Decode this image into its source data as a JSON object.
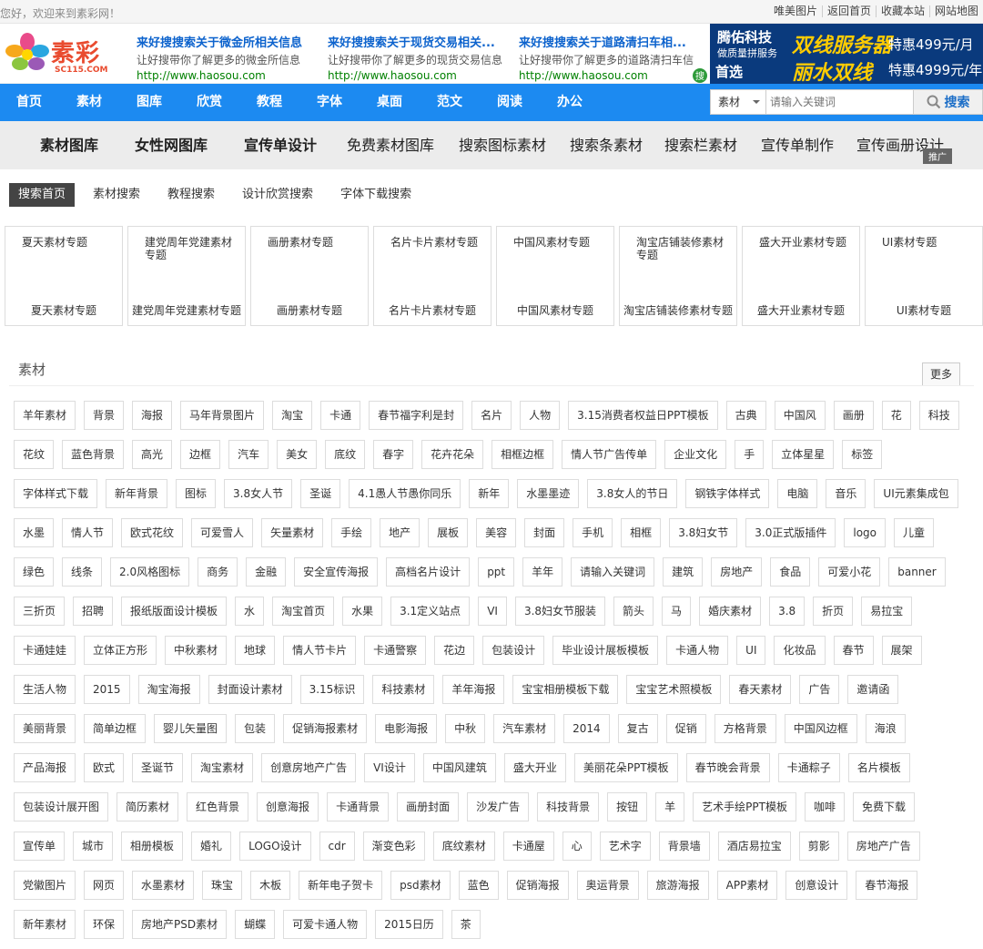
{
  "topbar": {
    "welcome": "您好，欢迎来到素彩网！",
    "links": [
      "唯美图片",
      "返回首页",
      "收藏本站",
      "网站地图"
    ]
  },
  "logo": {
    "name": "素彩",
    "domain": "SC115.COM"
  },
  "ads": [
    {
      "title": "来好搜搜索关于微金所相关信息",
      "desc": "让好搜带你了解更多的微金所信息",
      "url": "http://www.haosou.com"
    },
    {
      "title": "来好搜搜索关于现货交易相关...",
      "desc": "让好搜带你了解更多的现货交易信息",
      "url": "http://www.haosou.com"
    },
    {
      "title": "来好搜搜索关于道路清扫车相...",
      "desc": "让好搜带你了解更多的道路清扫车信",
      "url": "http://www.haosou.com"
    }
  ],
  "banner": {
    "brand": "腾佑科技",
    "slogan": "做质量拼服务",
    "pick": "首选",
    "ad1": "双线服务器",
    "price1": "特惠499元/月",
    "ad2": "丽水双线",
    "price2": "特惠4999元/年"
  },
  "nav": {
    "items": [
      "首页",
      "素材",
      "图库",
      "欣赏",
      "教程",
      "字体",
      "桌面",
      "范文",
      "阅读",
      "办公"
    ]
  },
  "search": {
    "category": "素材",
    "placeholder": "请输入关键词",
    "button": "搜索"
  },
  "subnav": {
    "items": [
      "素材图库",
      "女性网图库",
      "宣传单设计",
      "免费素材图库",
      "搜索图标素材",
      "搜索条素材",
      "搜索栏素材",
      "宣传单制作",
      "宣传画册设计"
    ],
    "tag": "推广"
  },
  "tabs": [
    "搜索首页",
    "素材搜索",
    "教程搜索",
    "设计欣赏搜索",
    "字体下载搜索"
  ],
  "cards": [
    {
      "top": "夏天素材专题",
      "bottom": "夏天素材专题"
    },
    {
      "top": "建党周年党建素材专题",
      "bottom": "建党周年党建素材专题"
    },
    {
      "top": "画册素材专题",
      "bottom": "画册素材专题"
    },
    {
      "top": "名片卡片素材专题",
      "bottom": "名片卡片素材专题"
    },
    {
      "top": "中国风素材专题",
      "bottom": "中国风素材专题"
    },
    {
      "top": "淘宝店铺装修素材专题",
      "bottom": "淘宝店铺装修素材专题"
    },
    {
      "top": "盛大开业素材专题",
      "bottom": "盛大开业素材专题"
    },
    {
      "top": "UI素材专题",
      "bottom": "UI素材专题"
    }
  ],
  "section": {
    "title": "素材",
    "more": "更多"
  },
  "tags": [
    "羊年素材",
    "背景",
    "海报",
    "马年背景图片",
    "淘宝",
    "卡通",
    "春节福字利是封",
    "名片",
    "人物",
    "3.15消费者权益日PPT模板",
    "古典",
    "中国风",
    "画册",
    "花",
    "科技",
    "花纹",
    "蓝色背景",
    "高光",
    "边框",
    "汽车",
    "美女",
    "底纹",
    "春字",
    "花卉花朵",
    "相框边框",
    "情人节广告传单",
    "企业文化",
    "手",
    "立体星星",
    "标签",
    "字体样式下载",
    "新年背景",
    "图标",
    "3.8女人节",
    "圣诞",
    "4.1愚人节愚你同乐",
    "新年",
    "水墨墨迹",
    "3.8女人的节日",
    "钢铁字体样式",
    "电脑",
    "音乐",
    "UI元素集成包",
    "水墨",
    "情人节",
    "欧式花纹",
    "可爱雪人",
    "矢量素材",
    "手绘",
    "地产",
    "展板",
    "美容",
    "封面",
    "手机",
    "相框",
    "3.8妇女节",
    "3.0正式版插件",
    "logo",
    "儿童",
    "绿色",
    "线条",
    "2.0风格图标",
    "商务",
    "金融",
    "安全宣传海报",
    "高档名片设计",
    "ppt",
    "羊年",
    "请输入关键词",
    "建筑",
    "房地产",
    "食品",
    "可爱小花",
    "banner",
    "三折页",
    "招聘",
    "报纸版面设计模板",
    "水",
    "淘宝首页",
    "水果",
    "3.1定义站点",
    "VI",
    "3.8妇女节服装",
    "箭头",
    "马",
    "婚庆素材",
    "3.8",
    "折页",
    "易拉宝",
    "卡通娃娃",
    "立体正方形",
    "中秋素材",
    "地球",
    "情人节卡片",
    "卡通警察",
    "花边",
    "包装设计",
    "毕业设计展板模板",
    "卡通人物",
    "UI",
    "化妆品",
    "春节",
    "展架",
    "生活人物",
    "2015",
    "淘宝海报",
    "封面设计素材",
    "3.15标识",
    "科技素材",
    "羊年海报",
    "宝宝相册模板下载",
    "宝宝艺术照模板",
    "春天素材",
    "广告",
    "邀请函",
    "美丽背景",
    "简单边框",
    "婴儿矢量图",
    "包装",
    "促销海报素材",
    "电影海报",
    "中秋",
    "汽车素材",
    "2014",
    "复古",
    "促销",
    "方格背景",
    "中国风边框",
    "海浪",
    "产品海报",
    "欧式",
    "圣诞节",
    "淘宝素材",
    "创意房地产广告",
    "VI设计",
    "中国风建筑",
    "盛大开业",
    "美丽花朵PPT模板",
    "春节晚会背景",
    "卡通粽子",
    "名片模板",
    "包装设计展开图",
    "简历素材",
    "红色背景",
    "创意海报",
    "卡通背景",
    "画册封面",
    "沙发广告",
    "科技背景",
    "按钮",
    "羊",
    "艺术手绘PPT模板",
    "咖啡",
    "免费下载",
    "宣传单",
    "城市",
    "相册模板",
    "婚礼",
    "LOGO设计",
    "cdr",
    "渐变色彩",
    "底纹素材",
    "卡通屋",
    "心",
    "艺术字",
    "背景墙",
    "酒店易拉宝",
    "剪影",
    "房地产广告",
    "党徽图片",
    "网页",
    "水墨素材",
    "珠宝",
    "木板",
    "新年电子贺卡",
    "psd素材",
    "蓝色",
    "促销海报",
    "奥运背景",
    "旅游海报",
    "APP素材",
    "创意设计",
    "春节海报",
    "新年素材",
    "环保",
    "房地产PSD素材",
    "蝴蝶",
    "可爱卡通人物",
    "2015日历",
    "茶"
  ]
}
